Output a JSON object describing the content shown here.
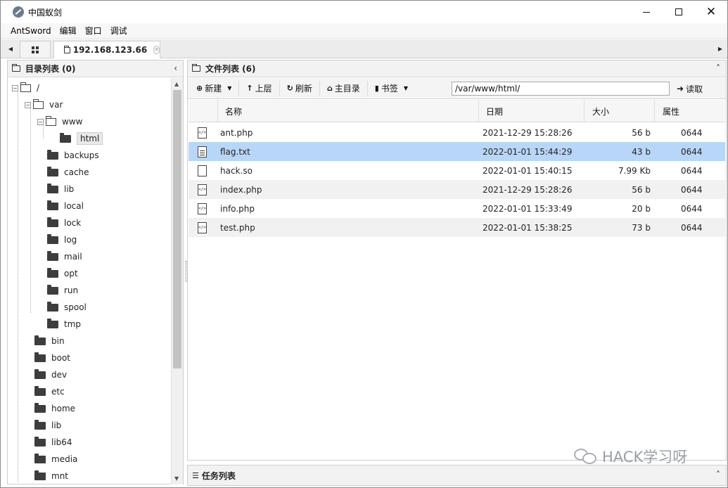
{
  "window": {
    "title": "中国蚁剑",
    "minimize": "—",
    "maximize": "☐",
    "close": "✕"
  },
  "menu": [
    "AntSword",
    "编辑",
    "窗口",
    "调试"
  ],
  "tabs": {
    "host_label": "192.168.123.66"
  },
  "left_panel": {
    "header": "目录列表 (0)",
    "collapse_glyph": "‹",
    "tree": [
      {
        "label": "/",
        "depth": 0,
        "type": "open"
      },
      {
        "label": "var",
        "depth": 1,
        "type": "open"
      },
      {
        "label": "www",
        "depth": 2,
        "type": "open"
      },
      {
        "label": "html",
        "depth": 3,
        "type": "solid",
        "selected": true
      },
      {
        "label": "backups",
        "depth": 2,
        "type": "solid"
      },
      {
        "label": "cache",
        "depth": 2,
        "type": "solid"
      },
      {
        "label": "lib",
        "depth": 2,
        "type": "solid"
      },
      {
        "label": "local",
        "depth": 2,
        "type": "solid"
      },
      {
        "label": "lock",
        "depth": 2,
        "type": "solid"
      },
      {
        "label": "log",
        "depth": 2,
        "type": "solid"
      },
      {
        "label": "mail",
        "depth": 2,
        "type": "solid"
      },
      {
        "label": "opt",
        "depth": 2,
        "type": "solid"
      },
      {
        "label": "run",
        "depth": 2,
        "type": "solid"
      },
      {
        "label": "spool",
        "depth": 2,
        "type": "solid"
      },
      {
        "label": "tmp",
        "depth": 2,
        "type": "solid"
      },
      {
        "label": "bin",
        "depth": 1,
        "type": "solid"
      },
      {
        "label": "boot",
        "depth": 1,
        "type": "solid"
      },
      {
        "label": "dev",
        "depth": 1,
        "type": "solid"
      },
      {
        "label": "etc",
        "depth": 1,
        "type": "solid"
      },
      {
        "label": "home",
        "depth": 1,
        "type": "solid"
      },
      {
        "label": "lib",
        "depth": 1,
        "type": "solid"
      },
      {
        "label": "lib64",
        "depth": 1,
        "type": "solid"
      },
      {
        "label": "media",
        "depth": 1,
        "type": "solid"
      },
      {
        "label": "mnt",
        "depth": 1,
        "type": "solid"
      }
    ]
  },
  "right_panel": {
    "header": "文件列表 (6)",
    "toolbar": {
      "new": "新建",
      "up": "上层",
      "refresh": "刷新",
      "home": "主目录",
      "bookmark": "书签",
      "path": "/var/www/html/",
      "read": "读取"
    },
    "columns": [
      "名称",
      "日期",
      "大小",
      "属性"
    ],
    "files": [
      {
        "name": "ant.php",
        "date": "2021-12-29 15:28:26",
        "size": "56 b",
        "perm": "0644",
        "kind": "code"
      },
      {
        "name": "flag.txt",
        "date": "2022-01-01 15:44:29",
        "size": "43 b",
        "perm": "0644",
        "kind": "txt",
        "selected": true
      },
      {
        "name": "hack.so",
        "date": "2022-01-01 15:40:15",
        "size": "7.99 Kb",
        "perm": "0644",
        "kind": "blank"
      },
      {
        "name": "index.php",
        "date": "2021-12-29 15:28:26",
        "size": "56 b",
        "perm": "0644",
        "kind": "code"
      },
      {
        "name": "info.php",
        "date": "2022-01-01 15:33:49",
        "size": "20 b",
        "perm": "0644",
        "kind": "code"
      },
      {
        "name": "test.php",
        "date": "2022-01-01 15:38:25",
        "size": "73 b",
        "perm": "0644",
        "kind": "code"
      }
    ]
  },
  "task_panel": {
    "header": "任务列表"
  },
  "watermark": {
    "text": "HACK学习呀"
  }
}
